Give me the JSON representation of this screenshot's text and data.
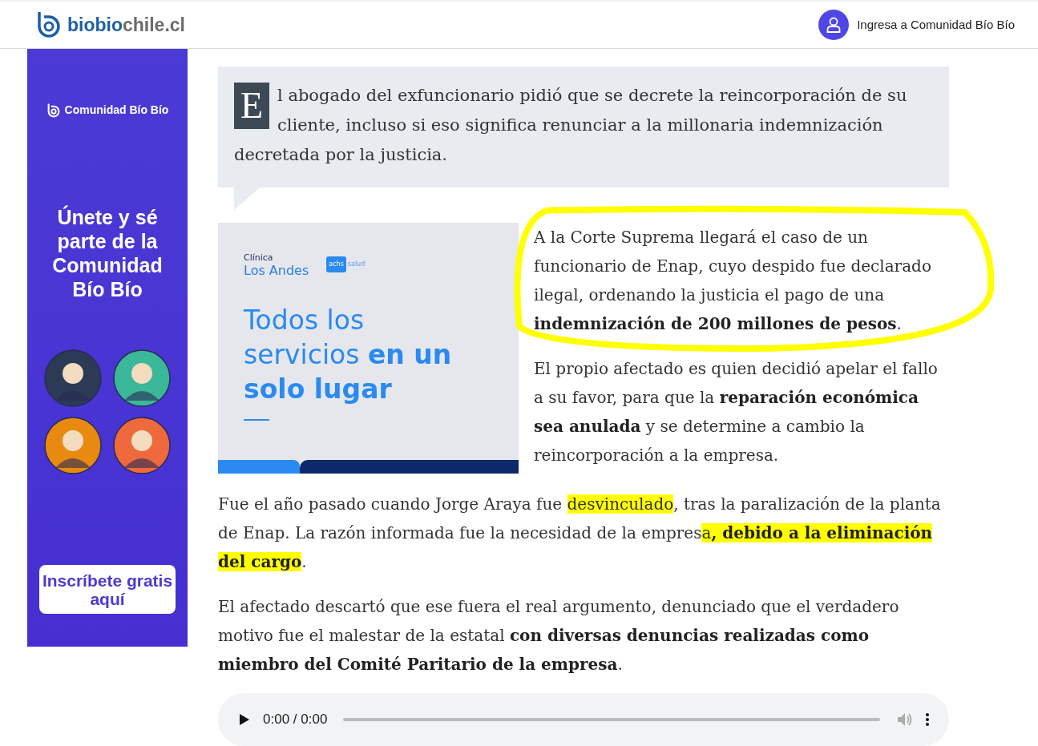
{
  "header": {
    "logo_parts": [
      "biobio",
      "chile.cl"
    ],
    "login_label": "Ingresa a Comunidad Bío Bío"
  },
  "side_ad": {
    "brand": "Comunidad Bío Bío",
    "headline": "Únete y sé parte de la Comunidad Bío Bío",
    "button": "Inscríbete gratis aquí"
  },
  "lead": {
    "drop_cap": "E",
    "text": "l abogado del exfuncionario pidió que se decrete la reincorporación de su cliente, incluso si eso significa renunciar a la millonaria indemnización decretada por la justicia."
  },
  "image_ad": {
    "brand_small": "Clínica",
    "brand": "Los Andes",
    "badge": "achs",
    "badge_suffix": "salud",
    "headline_light": "Todos los servicios",
    "headline_bold": "en un solo lugar"
  },
  "paragraphs": [
    {
      "circled": true,
      "segments": [
        {
          "text": "A la Corte Suprema llegará el caso de un funcionario de Enap, cuyo despido fue declarado ilegal, ordenando la justicia el pago de una ",
          "bold": false,
          "highlight": false
        },
        {
          "text": "indemnización de 200 millones de pesos",
          "bold": true,
          "highlight": false
        },
        {
          "text": ".",
          "bold": false,
          "highlight": false
        }
      ]
    },
    {
      "circled": false,
      "segments": [
        {
          "text": "El propio afectado es quien decidió apelar el fallo a su favor, para que la ",
          "bold": false,
          "highlight": false
        },
        {
          "text": "reparación económica sea anulada",
          "bold": true,
          "highlight": false
        },
        {
          "text": " y se determine a cambio la reincorporación a la empresa.",
          "bold": false,
          "highlight": false
        }
      ]
    },
    {
      "circled": false,
      "segments": [
        {
          "text": "Fue el año pasado cuando Jorge Araya fue ",
          "bold": false,
          "highlight": false
        },
        {
          "text": "desvinculado",
          "bold": false,
          "highlight": true
        },
        {
          "text": ", tras la paralización de la planta de Enap. La razón informada fue la necesidad de la empres",
          "bold": false,
          "highlight": false
        },
        {
          "text": "a",
          "bold": false,
          "highlight": true
        },
        {
          "text": ", debido a la eliminación del cargo",
          "bold": true,
          "highlight": true
        },
        {
          "text": ".",
          "bold": false,
          "highlight": false
        }
      ]
    },
    {
      "circled": false,
      "segments": [
        {
          "text": "El afectado descartó que ese fuera el real argumento, denunciado que el verdadero motivo fue el malestar de la estatal ",
          "bold": false,
          "highlight": false
        },
        {
          "text": "con diversas denuncias realizadas como miembro del Comité Paritario de la empresa",
          "bold": true,
          "highlight": false
        },
        {
          "text": ".",
          "bold": false,
          "highlight": false
        }
      ]
    }
  ],
  "audio": {
    "time": "0:00 / 0:00"
  }
}
